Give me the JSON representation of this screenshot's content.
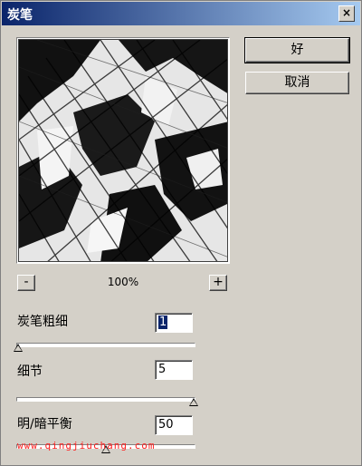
{
  "window": {
    "title": "炭笔",
    "close_glyph": "×"
  },
  "buttons": {
    "ok_label": "好",
    "cancel_label": "取消"
  },
  "zoom": {
    "minus_label": "-",
    "plus_label": "+",
    "level": "100%"
  },
  "params": [
    {
      "label": "炭笔粗细",
      "value": "1",
      "slider_fraction": 0.0
    },
    {
      "label": "细节",
      "value": "5",
      "slider_fraction": 1.0
    },
    {
      "label": "明/暗平衡",
      "value": "50",
      "slider_fraction": 0.5
    }
  ],
  "watermark": "www.qingjiuchang.com"
}
